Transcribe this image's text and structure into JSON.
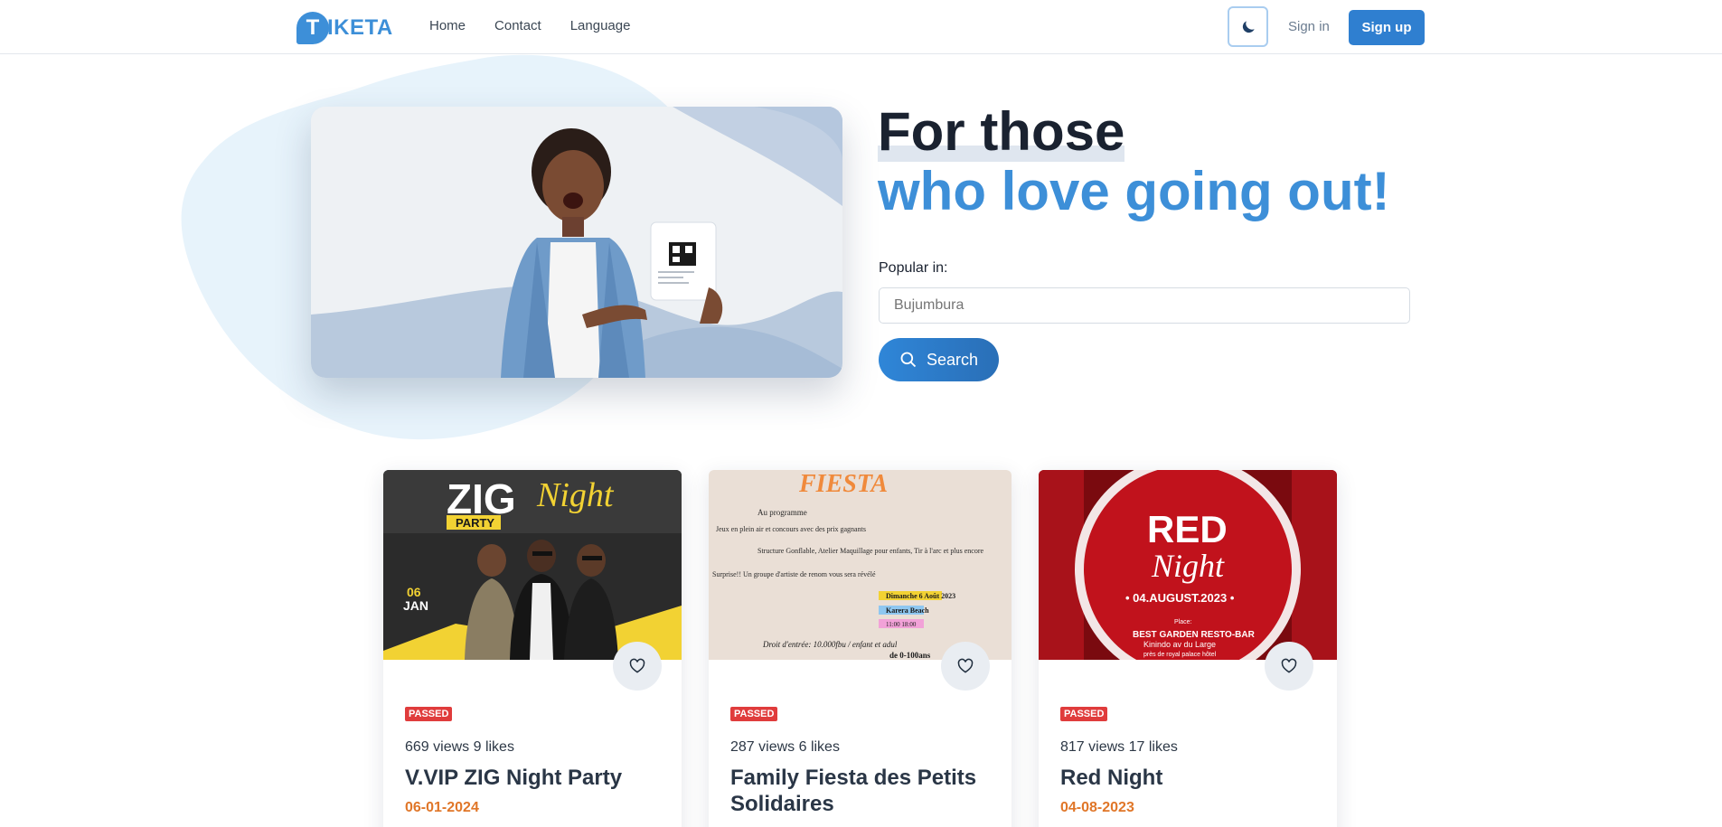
{
  "nav": {
    "logo_letter": "T",
    "logo_text": "IKETA",
    "links": [
      "Home",
      "Contact",
      "Language"
    ],
    "theme_icon": "moon-icon",
    "signin": "Sign in",
    "signup": "Sign up"
  },
  "hero": {
    "title_line1": "For those",
    "title_line2": "who love going out!",
    "popular_label": "Popular in:",
    "city_placeholder": "Bujumbura",
    "search_label": "Search",
    "search_icon": "search-icon"
  },
  "events": [
    {
      "badge": "PASSED",
      "stats": "669 views 9 likes",
      "title": "V.VIP ZIG Night Party",
      "date": "06-01-2024",
      "poster": {
        "line1": "ZIG",
        "line2": "Night",
        "line3": "PARTY",
        "date_day": "06",
        "date_month": "JAN"
      }
    },
    {
      "badge": "PASSED",
      "stats": "287 views 6 likes",
      "title": "Family Fiesta des Petits Solidaires",
      "date": "",
      "poster": {
        "heading": "FIESTA",
        "program": "Au programme",
        "l1": "Jeux en plein air et concours avec des prix gagnants",
        "l2": "Structure Gonflable, Atelier Maquillage pour enfants, Tir à l'arc et plus encore",
        "l3": "Surprise!! Un groupe d'artiste de renom vous sera révélé",
        "when": "Dimanche 6 Août 2023",
        "where": "Karera Beach",
        "hours": "11:00   18:00",
        "entry": "Droit d'entrée:   10.000fbu / enfant et adul",
        "ages": "de 0-100ans"
      }
    },
    {
      "badge": "PASSED",
      "stats": "817 views 17 likes",
      "title": "Red Night",
      "date": "04-08-2023",
      "poster": {
        "word1": "RED",
        "word2": "Night",
        "date": "• 04.AUGUST.2023 •",
        "place": "Place:",
        "venue": "BEST GARDEN RESTO-BAR",
        "venue2": "Kinindo av du Large",
        "venue3": "près de royal palace hôtel"
      }
    }
  ],
  "colors": {
    "accent": "#3d8fd8",
    "badge": "#e03c3c",
    "date": "#e07628"
  }
}
